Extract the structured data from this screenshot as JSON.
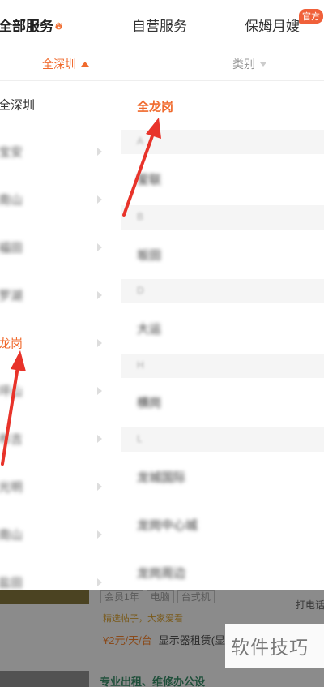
{
  "tabs": {
    "all_services": "全部服务",
    "fire_icon": "fire-icon",
    "self_operated": "自营服务",
    "nanny": "保姆月嫂",
    "official_badge": "官方"
  },
  "filters": {
    "city": "全深圳",
    "category": "类别"
  },
  "left_list": {
    "items": [
      {
        "label": "全深圳"
      },
      {
        "label": "宝安"
      },
      {
        "label": "南山"
      },
      {
        "label": "福田"
      },
      {
        "label": "罗湖"
      },
      {
        "label": "龙岗"
      },
      {
        "label": "坪山"
      },
      {
        "label": "布吉"
      },
      {
        "label": "光明"
      },
      {
        "label": "南山"
      },
      {
        "label": "盐田"
      }
    ],
    "active_label": "龙岗"
  },
  "right_list": {
    "top": "全龙岗",
    "sections": [
      {
        "letter": "A",
        "items": [
          "爱联"
        ]
      },
      {
        "letter": "B",
        "items": [
          "坂田"
        ]
      },
      {
        "letter": "D",
        "items": [
          "大运"
        ]
      },
      {
        "letter": "H",
        "items": [
          "横岗"
        ]
      },
      {
        "letter": "L",
        "items": [
          "龙城国际",
          "龙岗中心城",
          "龙岗周边"
        ]
      }
    ]
  },
  "background_listing": {
    "tags": [
      "会员1年",
      "电脑",
      "台式机"
    ],
    "promo": "精选帖子，大家爱看",
    "price": "¥2元/天/台",
    "name": "显示器租赁(显示器)",
    "call": "打电话",
    "next_title": "专业出租、维修办公设"
  },
  "watermark": "软件技巧",
  "colors": {
    "accent": "#f06a2d",
    "arrow": "#e8332a"
  }
}
